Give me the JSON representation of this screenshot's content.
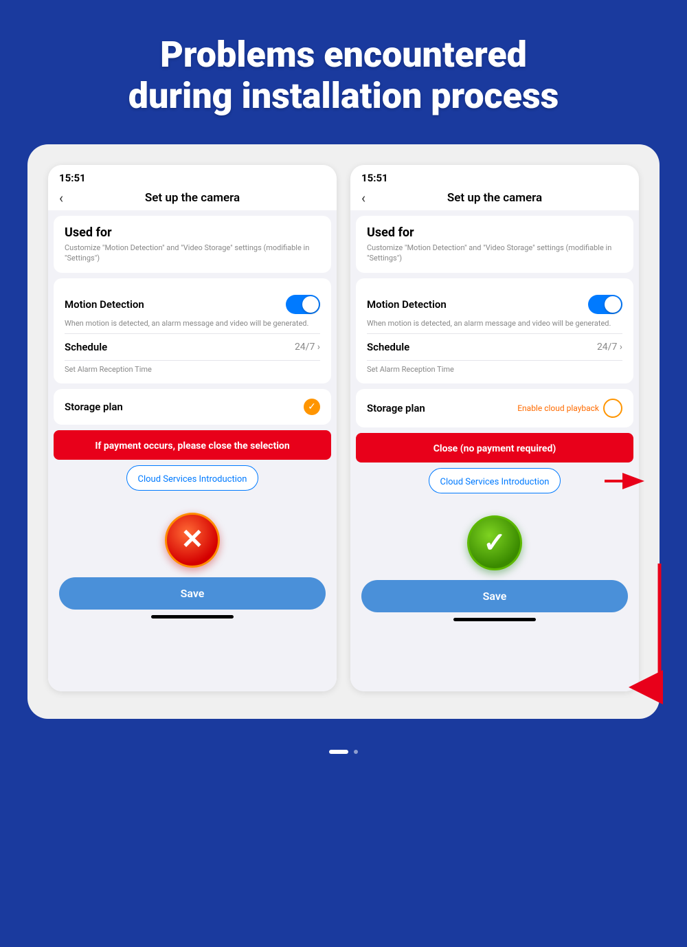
{
  "header": {
    "title_line1": "Problems encountered",
    "title_line2": "during installation process",
    "background_color": "#1a3a9e"
  },
  "left_phone": {
    "status_time": "15:51",
    "nav_back": "‹",
    "nav_title": "Set up  the camera",
    "used_for_title": "Used for",
    "used_for_subtitle": "Customize \"Motion Detection\" and \"Video Storage\" settings (modifiable in \"Settings\")",
    "motion_detection_label": "Motion Detection",
    "motion_detection_description": "When motion is detected, an alarm message and video will be generated.",
    "schedule_label": "Schedule",
    "schedule_value": "24/7 ›",
    "alarm_label": "Set Alarm Reception Time",
    "storage_plan_label": "Storage plan",
    "storage_check": "✓",
    "red_banner_text": "If payment occurs, please close the selection",
    "cloud_intro_text": "Cloud Services Introduction",
    "save_label": "Save",
    "icon_type": "error"
  },
  "right_phone": {
    "status_time": "15:51",
    "nav_back": "‹",
    "nav_title": "Set up  the camera",
    "used_for_title": "Used for",
    "used_for_subtitle": "Customize \"Motion Detection\" and \"Video Storage\" settings (modifiable in \"Settings\")",
    "motion_detection_label": "Motion Detection",
    "motion_detection_description": "When motion is detected, an alarm message and video will be generated.",
    "schedule_label": "Schedule",
    "schedule_value": "24/7 ›",
    "alarm_label": "Set Alarm Reception Time",
    "storage_plan_label": "Storage plan",
    "enable_cloud_text": "Enable cloud playback",
    "red_banner_text": "Close (no payment required)",
    "cloud_intro_text": "Cloud Services Introduction",
    "save_label": "Save",
    "icon_type": "success"
  },
  "bottom_nav": {
    "dot_active": "white",
    "dot_inactive": "gray"
  }
}
